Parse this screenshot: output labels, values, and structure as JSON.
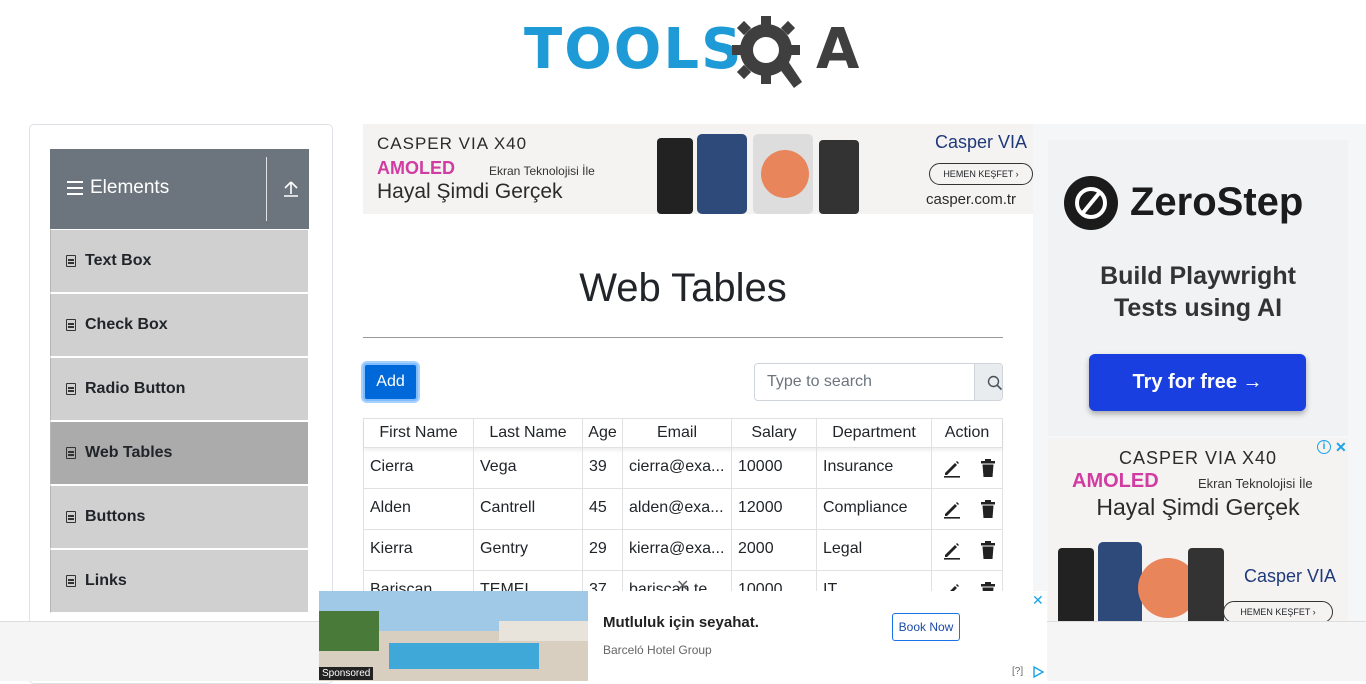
{
  "logo": {
    "text": "TOOLS",
    "suffix": "A"
  },
  "sidebar": {
    "group_title": "Elements",
    "items": [
      {
        "label": "Text Box"
      },
      {
        "label": "Check Box"
      },
      {
        "label": "Radio Button"
      },
      {
        "label": "Web Tables",
        "active": true
      },
      {
        "label": "Buttons"
      },
      {
        "label": "Links"
      }
    ]
  },
  "ad_top": {
    "brand": "CASPER VIA X40",
    "amoled": "AMOLED",
    "amoled_sub": "Ekran Teknolojisi İle",
    "tagline": "Hayal Şimdi Gerçek",
    "logo": "Casper VIA",
    "cta": "HEMEN KEŞFET ›",
    "url": "casper.com.tr"
  },
  "page": {
    "title": "Web Tables"
  },
  "toolbar": {
    "add_label": "Add",
    "search_placeholder": "Type to search"
  },
  "table": {
    "headers": [
      "First Name",
      "Last Name",
      "Age",
      "Email",
      "Salary",
      "Department",
      "Action"
    ],
    "rows": [
      [
        "Cierra",
        "Vega",
        "39",
        "cierra@exa...",
        "10000",
        "Insurance"
      ],
      [
        "Alden",
        "Cantrell",
        "45",
        "alden@exa...",
        "12000",
        "Compliance"
      ],
      [
        "Kierra",
        "Gentry",
        "29",
        "kierra@exa...",
        "2000",
        "Legal"
      ],
      [
        "Bariscan",
        "TEMEL",
        "37",
        "bariscan.te...",
        "10000",
        "IT"
      ]
    ]
  },
  "ad_right": {
    "name": "ZeroStep",
    "tagline": "Build Playwright Tests using AI",
    "cta": "Try for free →"
  },
  "ad_right2": {
    "brand": "CASPER VIA X40",
    "amoled": "AMOLED",
    "amoled_sub": "Ekran Teknolojisi İle",
    "tagline": "Hayal Şimdi Gerçek",
    "logo": "Casper VIA",
    "cta": "HEMEN KEŞFET ›"
  },
  "bottom_ad": {
    "sponsored": "Sponsored",
    "headline": "Mutluluk için seyahat.",
    "advertiser": "Barceló Hotel Group",
    "cta": "Book Now",
    "help": "[?]"
  },
  "colors": {
    "primary": "#007bff",
    "sidebar_header": "#6c757d",
    "menu_bg": "#d0d0d0",
    "menu_active": "#ababab",
    "logo_blue": "#1e9bd7"
  }
}
